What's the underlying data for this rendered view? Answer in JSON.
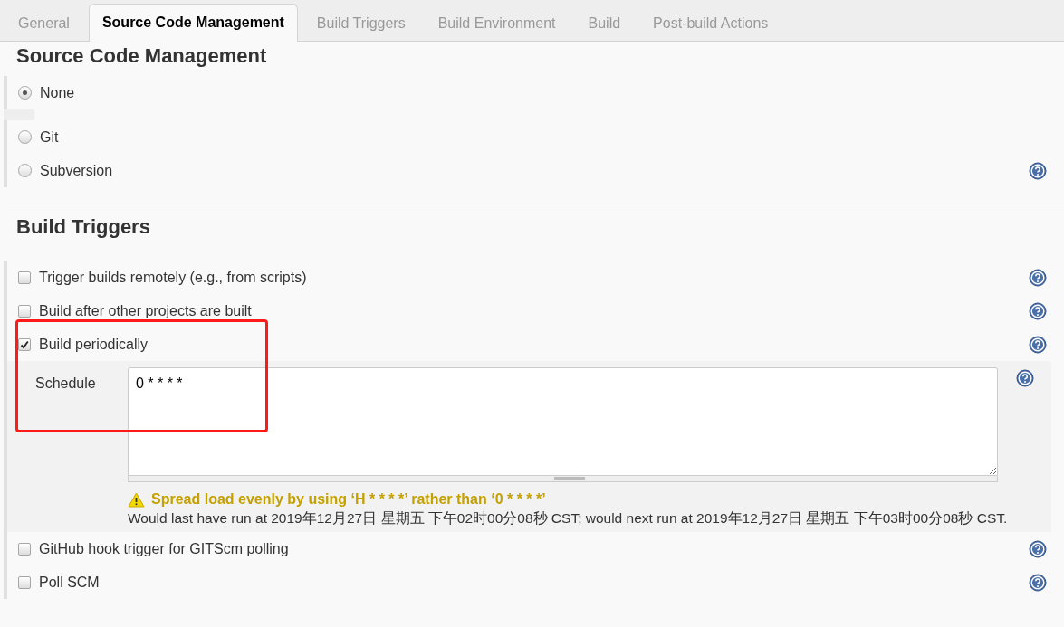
{
  "tabs": [
    {
      "label": "General",
      "selected": false
    },
    {
      "label": "Source Code Management",
      "selected": true
    },
    {
      "label": "Build Triggers",
      "selected": false
    },
    {
      "label": "Build Environment",
      "selected": false
    },
    {
      "label": "Build",
      "selected": false
    },
    {
      "label": "Post-build Actions",
      "selected": false
    }
  ],
  "scm": {
    "heading": "Source Code Management",
    "options": [
      {
        "label": "None",
        "selected": true,
        "help": false
      },
      {
        "label": "Git",
        "selected": false,
        "help": false
      },
      {
        "label": "Subversion",
        "selected": false,
        "help": true
      }
    ]
  },
  "triggers": {
    "heading": "Build Triggers",
    "items": [
      {
        "label": "Trigger builds remotely (e.g., from scripts)",
        "checked": false,
        "help": true,
        "highlighted": false
      },
      {
        "label": "Build after other projects are built",
        "checked": false,
        "help": true,
        "highlighted": false
      },
      {
        "label": "Build periodically",
        "checked": true,
        "help": true,
        "highlighted": true,
        "schedule": {
          "label": "Schedule",
          "value": "0 * * * *",
          "warning": "Spread load evenly by using ‘H * * * *’ rather than ‘0 * * * *’",
          "message": "Would last have run at 2019年12月27日 星期五 下午02时00分08秒 CST; would next run at 2019年12月27日 星期五 下午03时00分08秒 CST."
        }
      },
      {
        "label": "GitHub hook trigger for GITScm polling",
        "checked": false,
        "help": true,
        "highlighted": false
      },
      {
        "label": "Poll SCM",
        "checked": false,
        "help": true,
        "highlighted": false
      }
    ]
  }
}
